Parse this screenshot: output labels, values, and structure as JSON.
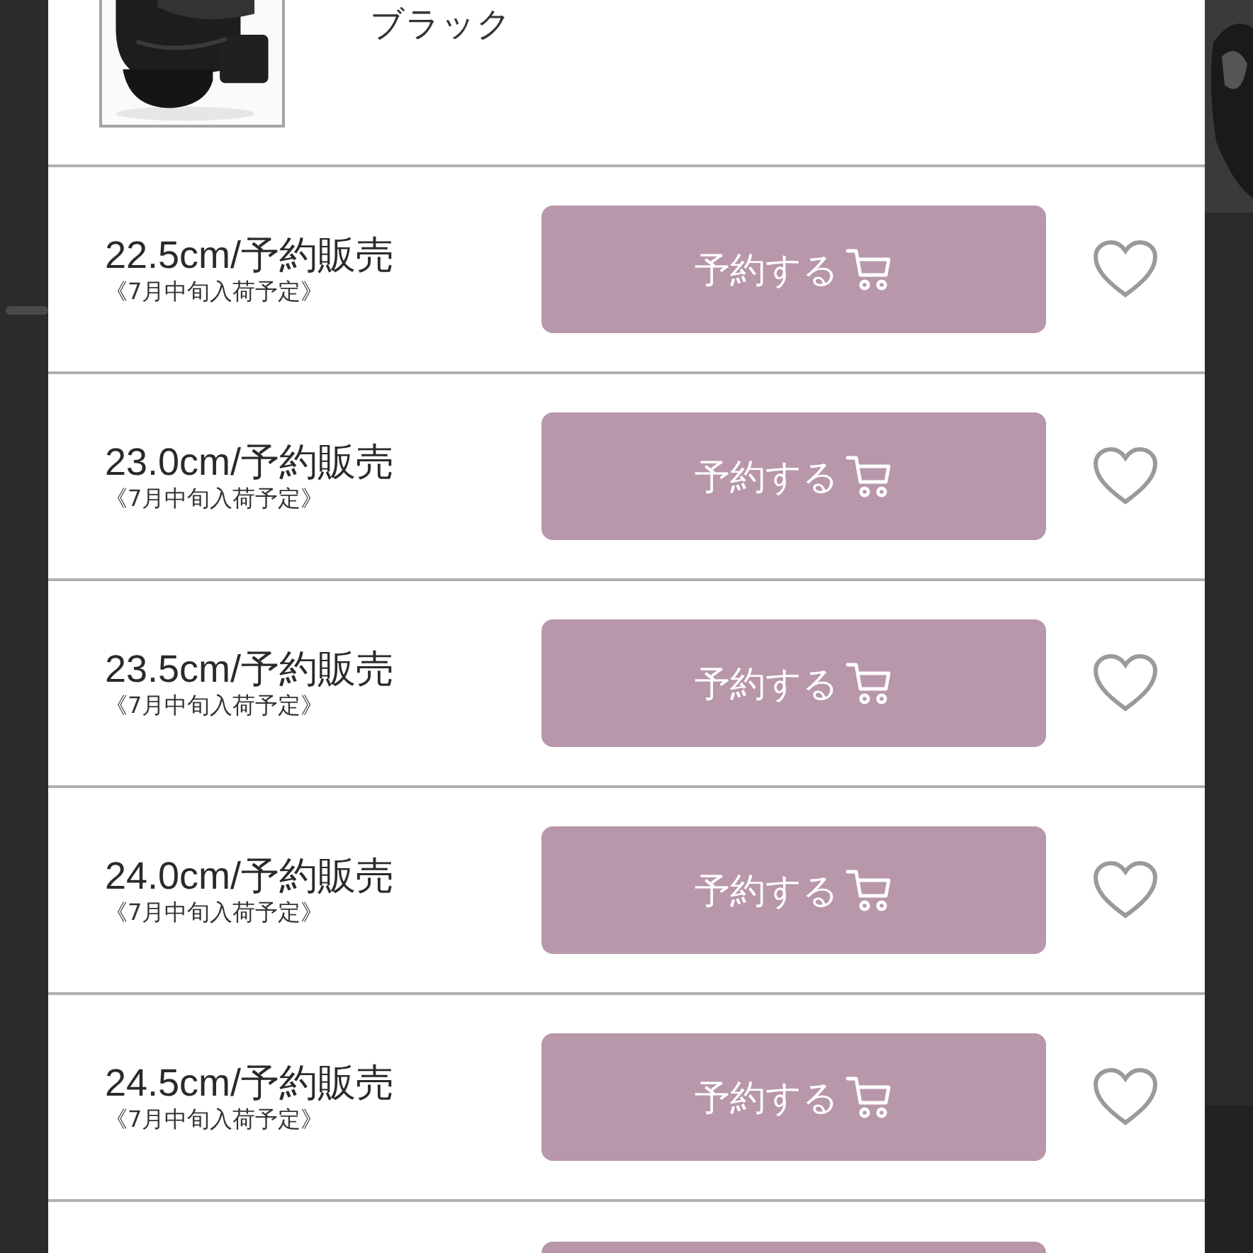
{
  "product": {
    "color_name": "ブラック"
  },
  "sizes": [
    {
      "kind": "full",
      "size": "22.5cm/予約販売",
      "note": "《7月中旬入荷予定》",
      "button": "予約する",
      "favorite": false
    },
    {
      "kind": "full",
      "size": "23.0cm/予約販売",
      "note": "《7月中旬入荷予定》",
      "button": "予約する",
      "favorite": false
    },
    {
      "kind": "full",
      "size": "23.5cm/予約販売",
      "note": "《7月中旬入荷予定》",
      "button": "予約する",
      "favorite": false
    },
    {
      "kind": "full",
      "size": "24.0cm/予約販売",
      "note": "《7月中旬入荷予定》",
      "button": "予約する",
      "favorite": false
    },
    {
      "kind": "full",
      "size": "24.5cm/予約販売",
      "note": "《7月中旬入荷予定》",
      "button": "予約する",
      "favorite": false
    },
    {
      "kind": "cut"
    }
  ]
}
